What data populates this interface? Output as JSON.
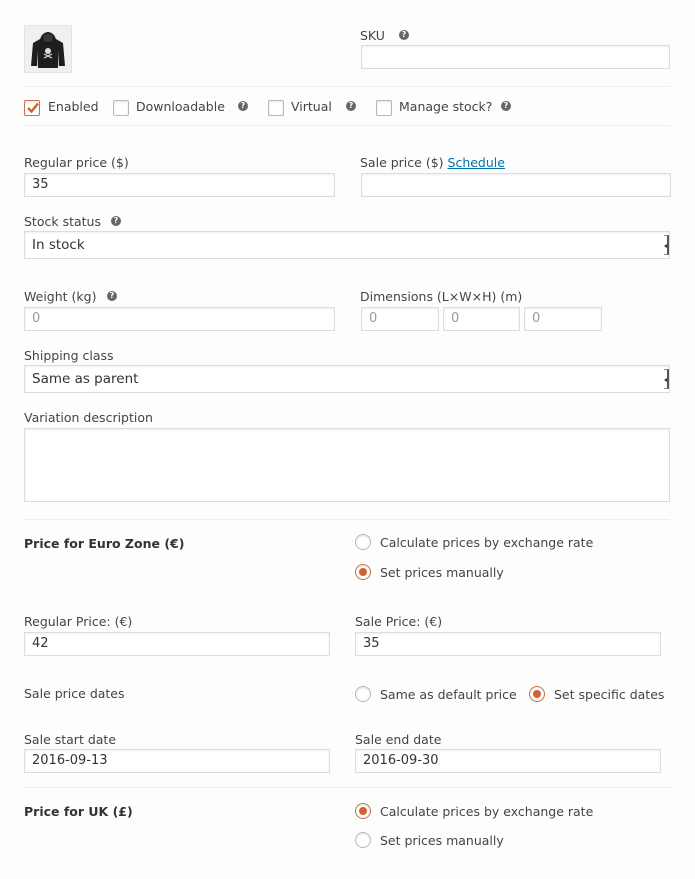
{
  "sku": {
    "label": "SKU",
    "value": ""
  },
  "options": {
    "enabled": {
      "label": "Enabled",
      "checked": true
    },
    "downloadable": {
      "label": "Downloadable",
      "checked": false
    },
    "virtual": {
      "label": "Virtual",
      "checked": false
    },
    "manage_stock": {
      "label": "Manage stock?",
      "checked": false
    }
  },
  "regular_price": {
    "label": "Regular price ($)",
    "value": "35"
  },
  "sale_price": {
    "label": "Sale price ($)",
    "schedule_link": "Schedule",
    "value": ""
  },
  "stock_status": {
    "label": "Stock status",
    "value": "In stock"
  },
  "weight": {
    "label": "Weight (kg)",
    "placeholder": "0"
  },
  "dimensions": {
    "label": "Dimensions (L×W×H) (m)",
    "placeholders": [
      "0",
      "0",
      "0"
    ]
  },
  "shipping_class": {
    "label": "Shipping class",
    "value": "Same as parent"
  },
  "variation_description": {
    "label": "Variation description",
    "value": ""
  },
  "euro_zone": {
    "title": "Price for Euro Zone (€)",
    "radio_exchange": {
      "label": "Calculate prices by exchange rate",
      "selected": false
    },
    "radio_manual": {
      "label": "Set prices manually",
      "selected": true
    },
    "regular_price": {
      "label": "Regular Price: (€)",
      "value": "42"
    },
    "sale_price": {
      "label": "Sale Price: (€)",
      "value": "35"
    },
    "sale_price_dates": {
      "label": "Sale price dates",
      "radio_default": {
        "label": "Same as default price",
        "selected": false
      },
      "radio_specific": {
        "label": "Set specific dates",
        "selected": true
      }
    },
    "sale_start": {
      "label": "Sale start date",
      "value": "2016-09-13"
    },
    "sale_end": {
      "label": "Sale end date",
      "value": "2016-09-30"
    }
  },
  "uk": {
    "title": "Price for UK (£)",
    "radio_exchange": {
      "label": "Calculate prices by exchange rate",
      "selected": true
    },
    "radio_manual": {
      "label": "Set prices manually",
      "selected": false
    }
  },
  "icons": {
    "help": "?",
    "product_image": "hoodie-thumbnail"
  },
  "colors": {
    "accent": "#d0622e",
    "link": "#0073aa"
  }
}
